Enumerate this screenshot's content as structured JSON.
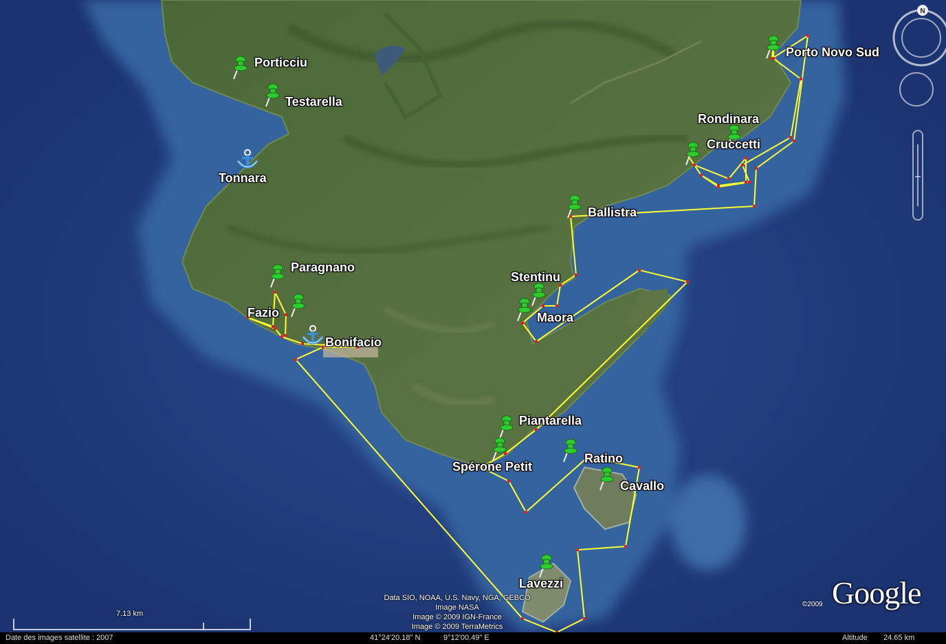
{
  "map": {
    "water_color": "#24407e",
    "shallow_water_color": "#3a6aa0",
    "land_color": "#4d6a3a",
    "route_color": "#ffff33",
    "waypoint_color": "#e02020",
    "pin_color": "#2ecc2e"
  },
  "placemarks": [
    {
      "name": "Porticciu",
      "icon": "green-pushpin-icon"
    },
    {
      "name": "Testarella",
      "icon": "green-pushpin-icon"
    },
    {
      "name": "Tonnara",
      "icon": "anchor-icon"
    },
    {
      "name": "Porto Novo Sud",
      "icon": "green-pushpin-icon"
    },
    {
      "name": "Rondinara",
      "icon": "green-pushpin-icon"
    },
    {
      "name": "Cruccetti",
      "icon": "green-pushpin-icon"
    },
    {
      "name": "Ballistra",
      "icon": "green-pushpin-icon"
    },
    {
      "name": "Paragnano",
      "icon": "green-pushpin-icon"
    },
    {
      "name": "Fazio",
      "icon": "green-pushpin-icon"
    },
    {
      "name": "Bonifacio",
      "icon": "anchor-icon"
    },
    {
      "name": "Stentinu",
      "icon": "green-pushpin-icon"
    },
    {
      "name": "Maora",
      "icon": "green-pushpin-icon"
    },
    {
      "name": "Piantarella",
      "icon": "green-pushpin-icon"
    },
    {
      "name": "Ratino",
      "icon": "green-pushpin-icon"
    },
    {
      "name": "Spérone Petit",
      "icon": "green-pushpin-icon"
    },
    {
      "name": "Cavallo",
      "icon": "green-pushpin-icon"
    },
    {
      "name": "Lavezzi",
      "icon": "green-pushpin-icon"
    }
  ],
  "copyright": [
    "Data SIO, NOAA, U.S. Navy, NGA, GEBCO",
    "Image NASA",
    "Image © 2009 IGN-France",
    "Image © 2009 TerraMetrics"
  ],
  "logo": {
    "text": "Google",
    "year": "©2009"
  },
  "scale": {
    "label": "7.13 km"
  },
  "status": {
    "imagery_date": "Date des images satellite : 2007",
    "lat": "41°24'20.18\" N",
    "lon": "9°12'00.49\" E",
    "altitude_label": "Altitude",
    "altitude_value": "24.65 km"
  },
  "compass": {
    "north_label": "N"
  }
}
